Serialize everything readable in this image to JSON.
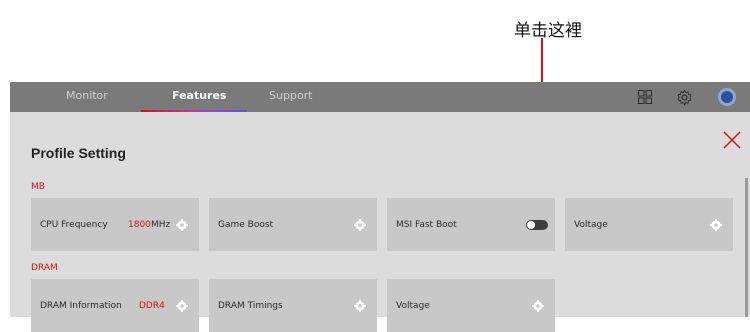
{
  "callout": {
    "text": "单击这裡"
  },
  "tabs": [
    "Monitor",
    "Features",
    "Support"
  ],
  "active_tab": "Features",
  "header_icons": [
    "grid-icon",
    "gear-icon",
    "avatar"
  ],
  "page": {
    "title": "Profile Setting"
  },
  "sections": {
    "mb": {
      "label": "MB",
      "cards": [
        {
          "name": "CPU Frequency",
          "value": "1800",
          "unit": "MHz",
          "control": "gear"
        },
        {
          "name": "Game Boost",
          "control": "gear"
        },
        {
          "name": "MSI Fast Boot",
          "control": "toggle",
          "state": "off"
        },
        {
          "name": "Voltage",
          "control": "gear"
        }
      ]
    },
    "dram": {
      "label": "DRAM",
      "cards": [
        {
          "name": "DRAM Information",
          "value": "DDR4",
          "control": "gear"
        },
        {
          "name": "DRAM Timings",
          "control": "gear"
        },
        {
          "name": "Voltage",
          "control": "gear"
        }
      ]
    }
  },
  "colors": {
    "accent": "#d4111e",
    "topbar": "#7a7a7a",
    "panel": "#dcdcdc",
    "card": "#c8c8c8"
  }
}
